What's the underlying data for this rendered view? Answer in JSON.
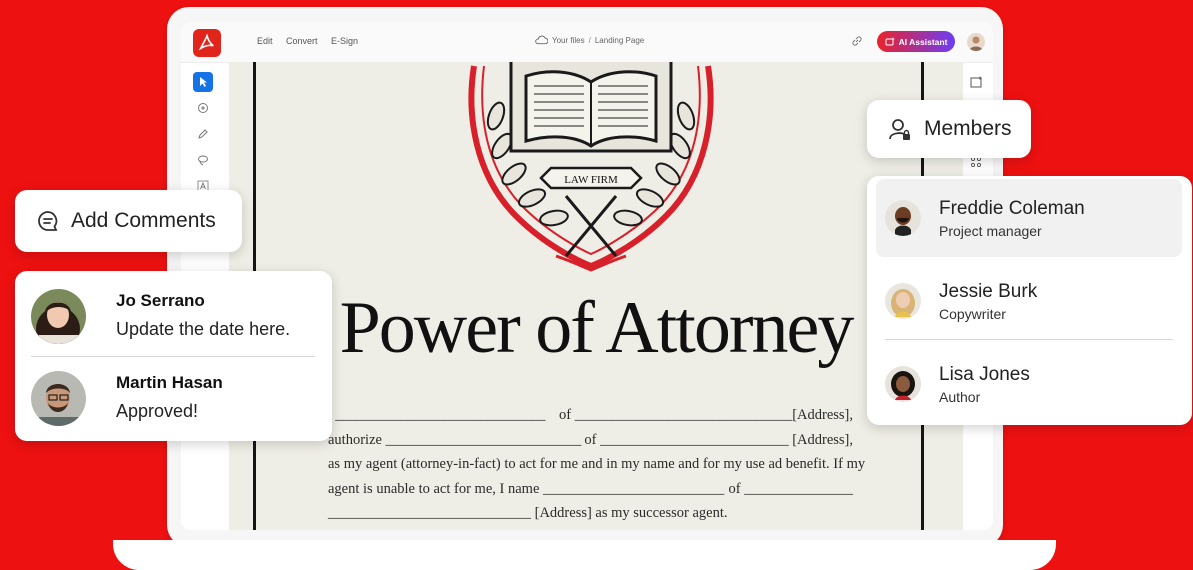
{
  "app": {
    "menu": [
      "Edit",
      "Convert",
      "E-Sign"
    ],
    "breadcrumb": {
      "root": "Your files",
      "separator": "/",
      "current": "Landing Page"
    },
    "ai_button_label": "AI Assistant",
    "accent_color": "#e1251b",
    "background_color": "#ee1111"
  },
  "document": {
    "emblem_text": "LAW FIRM",
    "title": "Power of Attorney",
    "lines": [
      [
        ", _____________________________",
        "of ______________________________[Address],"
      ],
      [
        "authorize ___________________________",
        "of __________________________ [Address],"
      ],
      [
        "as my agent (attorney-in-fact) to act for me and in my name and for my use ad benefit. If my"
      ],
      [
        "agent is unable to act for me, I name _________________________",
        "of _______________"
      ],
      [
        "____________________________ [Address] as my successor agent."
      ]
    ]
  },
  "add_comments": {
    "label": "Add Comments",
    "icon": "comment-icon"
  },
  "comments": [
    {
      "name": "Jo Serrano",
      "text": "Update the date here."
    },
    {
      "name": "Martin Hasan",
      "text": "Approved!"
    }
  ],
  "members_button": {
    "label": "Members",
    "icon": "members-icon"
  },
  "members": [
    {
      "name": "Freddie Coleman",
      "role": "Project manager",
      "selected": true
    },
    {
      "name": "Jessie Burk",
      "role": "Copywriter",
      "selected": false
    },
    {
      "name": "Lisa Jones",
      "role": "Author",
      "selected": false
    }
  ]
}
